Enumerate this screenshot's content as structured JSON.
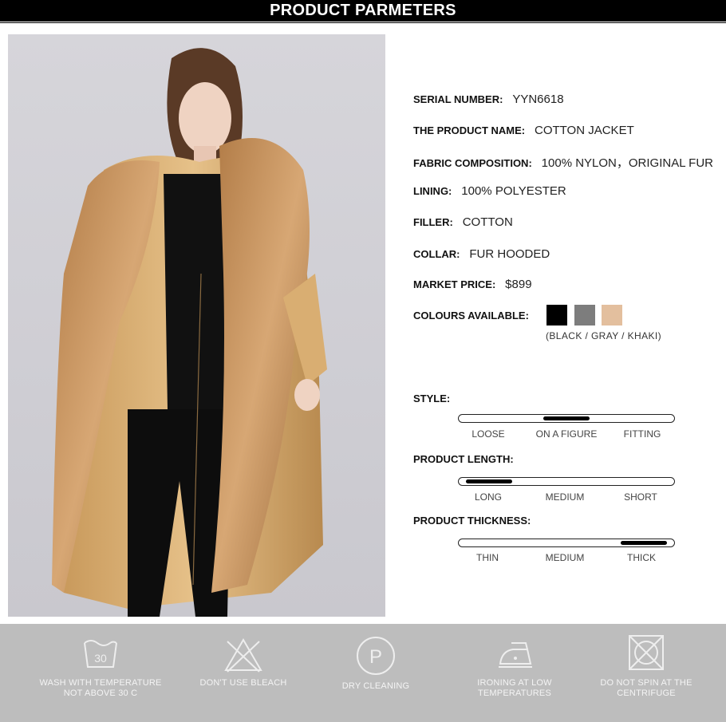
{
  "header": {
    "title": "PRODUCT PARMETERS"
  },
  "specs": {
    "serial_label": "SERIAL NUMBER:",
    "serial_value": "YYN6618",
    "name_label": "THE PRODUCT NAME:",
    "name_value": "COTTON JACKET",
    "fabric_label": "FABRIC COMPOSITION:",
    "fabric_value": "100% NYLON，ORIGINAL FUR",
    "lining_label": "LINING:",
    "lining_value": "100% POLYESTER",
    "filler_label": "FILLER:",
    "filler_value": "COTTON",
    "collar_label": "COLLAR:",
    "collar_value": "FUR HOODED",
    "price_label": "MARKET PRICE:",
    "price_value": "$899",
    "colours_label": "COLOURS AVAILABLE:",
    "colours_caption": "(BLACK / GRAY / KHAKI)",
    "colours": [
      "#000000",
      "#7d7d7d",
      "#e3bf9e"
    ]
  },
  "scales": {
    "style": {
      "title": "STYLE:",
      "ticks": [
        "LOOSE",
        "ON A FIGURE",
        "FITTING"
      ],
      "selected": "ON A FIGURE"
    },
    "length": {
      "title": "PRODUCT LENGTH:",
      "ticks": [
        "LONG",
        "MEDIUM",
        "SHORT"
      ],
      "selected": "LONG"
    },
    "thickness": {
      "title": "PRODUCT THICKNESS:",
      "ticks": [
        "THIN",
        "MEDIUM",
        "THICK"
      ],
      "selected": "THICK"
    }
  },
  "care": {
    "wash_number": "30",
    "items": [
      {
        "icon": "wash-tub-icon",
        "text": "WASH WITH TEMPERATURE\nNOT ABOVE 30 C"
      },
      {
        "icon": "no-bleach-icon",
        "text": "DON'T USE BLEACH"
      },
      {
        "icon": "dry-clean-icon",
        "text": "DRY CLEANING"
      },
      {
        "icon": "iron-low-icon",
        "text": "IRONING AT LOW\nTEMPERATURES"
      },
      {
        "icon": "no-spin-icon",
        "text": "DO NOT SPIN AT THE\nCENTRIFUGE"
      }
    ]
  },
  "colors": {
    "header_bg": "#000000",
    "care_band_bg": "#bdbdbd",
    "coat_khaki": "#e0b985"
  }
}
